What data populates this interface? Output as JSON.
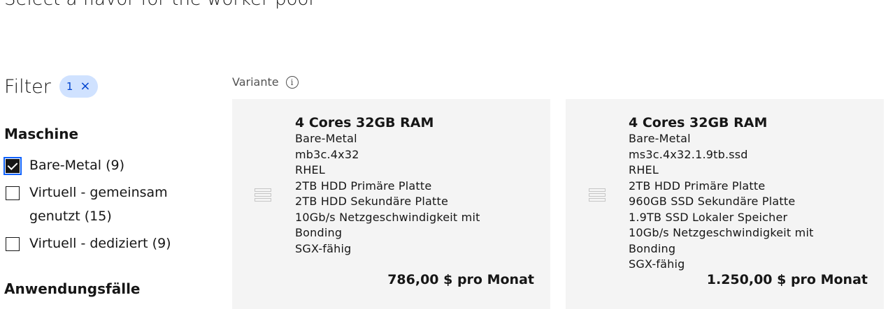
{
  "page": {
    "title": "Select a flavor for the worker pool"
  },
  "filter": {
    "title": "Filter",
    "tag_count": "1",
    "tag_clear": "×"
  },
  "machine": {
    "heading": "Maschine",
    "options": [
      {
        "label": "Bare-Metal (9)",
        "checked": true
      },
      {
        "label": "Virtuell - gemeinsam genutzt (15)",
        "checked": false
      },
      {
        "label": "Virtuell - dediziert (9)",
        "checked": false
      }
    ]
  },
  "use_cases": {
    "heading": "Anwendungsfälle"
  },
  "variant": {
    "label": "Variante",
    "info_icon": "info-icon",
    "info_glyph": "i"
  },
  "tiles": [
    {
      "title": "4 Cores 32GB RAM",
      "lines": [
        "Bare-Metal",
        "mb3c.4x32",
        "RHEL",
        "2TB HDD Primäre Platte",
        "2TB HDD Sekundäre Platte",
        "10Gb/s Netzgeschwindigkeit mit",
        "Bonding",
        "SGX-fähig"
      ],
      "price": "786,00 $ pro Monat"
    },
    {
      "title": "4 Cores 32GB RAM",
      "lines": [
        "Bare-Metal",
        "ms3c.4x32.1.9tb.ssd",
        "RHEL",
        "2TB HDD Primäre Platte",
        "960GB SSD Sekundäre Platte",
        "1.9TB SSD Lokaler Speicher",
        "10Gb/s Netzgeschwindigkeit mit",
        "Bonding",
        "SGX-fähig"
      ],
      "price": "1.250,00 $ pro Monat"
    }
  ],
  "colors": {
    "tag_bg": "#d0e2ff",
    "tag_fg": "#0043ce",
    "tile_bg": "#f4f4f4",
    "focus": "#0f62fe"
  }
}
